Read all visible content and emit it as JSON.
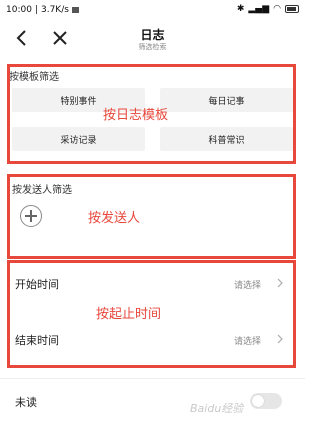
{
  "status_bar": {
    "time": "10:00",
    "network_speed": "3.7K/s",
    "battery": "full"
  },
  "nav": {
    "title": "日志",
    "subtitle": "筛选检索",
    "back_icon": "chevron-left-icon",
    "close_icon": "close-icon"
  },
  "template_filter": {
    "label": "按模板筛选",
    "buttons": [
      "特别事件",
      "每日记事",
      "采访记录",
      "科普常识"
    ],
    "annotation": "按日志模板"
  },
  "sender_filter": {
    "label": "按发送人筛选",
    "add_icon": "plus-circle-icon",
    "annotation": "按发送人"
  },
  "time_filter": {
    "start_label": "开始时间",
    "start_value": "请选择",
    "end_label": "结束时间",
    "end_value": "请选择",
    "annotation": "按起止时间"
  },
  "unread": {
    "label": "未读"
  },
  "watermark": "Baidu经验",
  "colors": {
    "annotation_red": "#e8473b",
    "button_bg": "#f2f2f2",
    "muted_text": "#888888"
  }
}
